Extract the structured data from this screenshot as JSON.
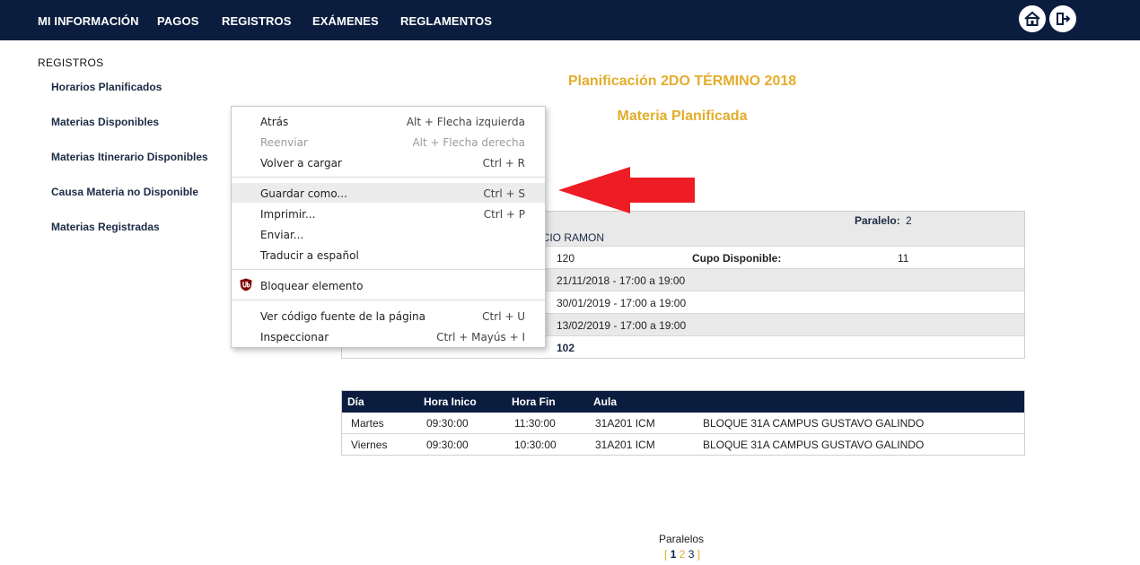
{
  "nav": {
    "items": [
      "MI INFORMACIÓN",
      "PAGOS",
      "REGISTROS",
      "EXÁMENES",
      "REGLAMENTOS"
    ],
    "icons": [
      "home-icon",
      "logout-icon"
    ]
  },
  "sidebar": {
    "title": "REGISTROS",
    "items": [
      "Horarios Planificados",
      "Materias Disponibles",
      "Materias Itinerario Disponibles",
      "Causa Materia no Disponible",
      "Materias Registradas"
    ]
  },
  "main": {
    "title": "Planificación 2DO TÉRMINO 2018",
    "subtitle": "Materia Planificada",
    "info": {
      "paralelo_label": "Paralelo:",
      "paralelo_value": "2",
      "profesor_partial": "NCIO RAMON",
      "cupo_total": "120",
      "cupo_label": "Cupo Disponible:",
      "cupo_value": "11",
      "exam1": "21/11/2018 - 17:00 a 19:00",
      "exam2": "30/01/2019 - 17:00 a 19:00",
      "exam3": "13/02/2019 - 17:00 a 19:00",
      "asociados_value": "102"
    },
    "schedule": {
      "headers": [
        "Día",
        "Hora Inico",
        "Hora Fin",
        "Aula"
      ],
      "rows": [
        {
          "dia": "Martes",
          "inicio": "09:30:00",
          "fin": "11:30:00",
          "aula": "31A201 ICM",
          "bloque": "BLOQUE 31A CAMPUS GUSTAVO GALINDO"
        },
        {
          "dia": "Viernes",
          "inicio": "09:30:00",
          "fin": "10:30:00",
          "aula": "31A201 ICM",
          "bloque": "BLOQUE 31A CAMPUS GUSTAVO GALINDO"
        }
      ]
    },
    "pagination": {
      "label": "Paralelos",
      "open": "[",
      "pages": [
        "1",
        "2",
        "3"
      ],
      "close": "]"
    }
  },
  "context_menu": {
    "items": [
      {
        "label": "Atrás",
        "shortcut": "Alt + Flecha izquierda"
      },
      {
        "label": "Reenviar",
        "shortcut": "Alt + Flecha derecha"
      },
      {
        "label": "Volver a cargar",
        "shortcut": "Ctrl + R"
      },
      {
        "label": "Guardar como...",
        "shortcut": "Ctrl + S"
      },
      {
        "label": "Imprimir...",
        "shortcut": "Ctrl + P"
      },
      {
        "label": "Enviar...",
        "shortcut": ""
      },
      {
        "label": "Traducir a español",
        "shortcut": ""
      },
      {
        "label": "Bloquear elemento",
        "shortcut": ""
      },
      {
        "label": "Ver código fuente de la página",
        "shortcut": "Ctrl + U"
      },
      {
        "label": "Inspeccionar",
        "shortcut": "Ctrl + Mayús + I"
      }
    ]
  },
  "colors": {
    "navy": "#0b1d3f",
    "gold": "#e3ad2b",
    "arrow_red": "#ee1c25"
  }
}
